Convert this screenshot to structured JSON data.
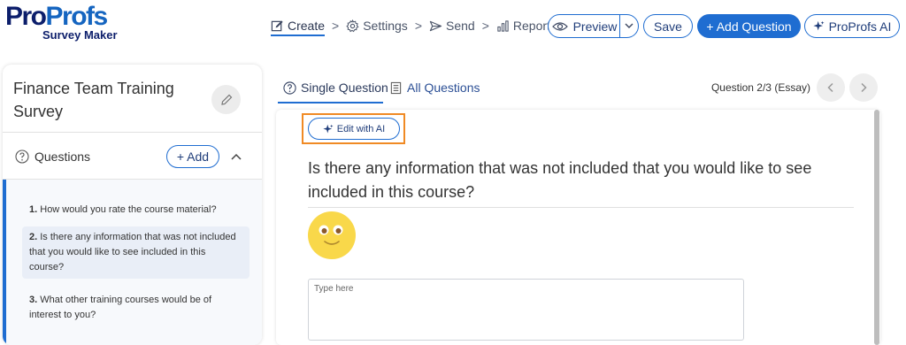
{
  "brand": {
    "logo_part1": "Pro",
    "logo_part2": "Profs",
    "logo_sub": "Survey Maker"
  },
  "nav": {
    "create": "Create",
    "settings": "Settings",
    "send": "Send",
    "reports": "Reports",
    "separator": ">"
  },
  "toolbar": {
    "preview": "Preview",
    "save": "Save",
    "add_question": "+ Add Question",
    "ai": "ProProfs AI"
  },
  "survey": {
    "title": "Finance Team Training Survey"
  },
  "questions_panel": {
    "label": "Questions",
    "add_label": "+ Add",
    "items": [
      {
        "num": "1.",
        "text": "How would you rate the course material?"
      },
      {
        "num": "2.",
        "text": "Is there any information that was not included that you would like to see included in this course?"
      },
      {
        "num": "3.",
        "text": "What other training courses would be of interest to you?"
      }
    ],
    "selected_index": 1
  },
  "tabs": {
    "single": "Single Question",
    "all": "All Questions"
  },
  "counter": "Question 2/3 (Essay)",
  "editor": {
    "edit_ai": "Edit with AI",
    "question_text": "Is there any information that was not included that you would like to see included in this course?",
    "answer_placeholder": "Type here"
  },
  "colors": {
    "accent": "#1f6dd1",
    "highlight": "#f08a24",
    "brand_dark": "#0c1e6b",
    "smiley": "#f9d84a"
  }
}
